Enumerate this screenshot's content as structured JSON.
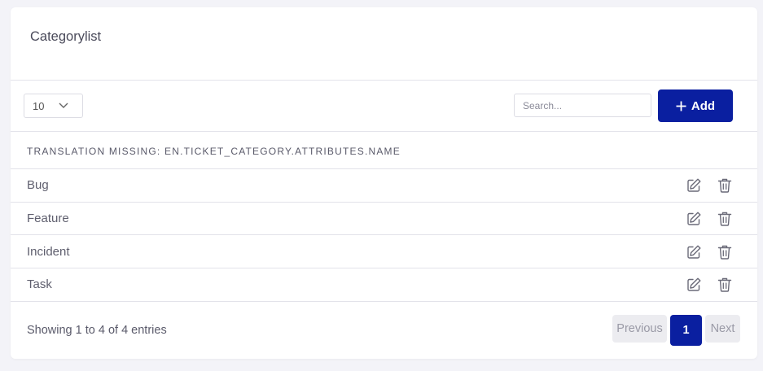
{
  "card": {
    "title": "Categorylist"
  },
  "toolbar": {
    "length_value": "10",
    "search_placeholder": "Search...",
    "add_label": "Add"
  },
  "table": {
    "header": "TRANSLATION MISSING: EN.TICKET_CATEGORY.ATTRIBUTES.NAME",
    "rows": [
      {
        "name": "Bug"
      },
      {
        "name": "Feature"
      },
      {
        "name": "Incident"
      },
      {
        "name": "Task"
      }
    ]
  },
  "footer": {
    "info": "Showing 1 to 4 of 4 entries",
    "previous_label": "Previous",
    "current_page": "1",
    "next_label": "Next"
  },
  "colors": {
    "primary": "#0a1fa0",
    "border": "#e3e3ea",
    "background": "#f3f3f8"
  },
  "icons": {
    "edit": "edit-icon",
    "delete": "trash-icon",
    "add": "plus-icon",
    "dropdown": "chevron-down-icon"
  }
}
